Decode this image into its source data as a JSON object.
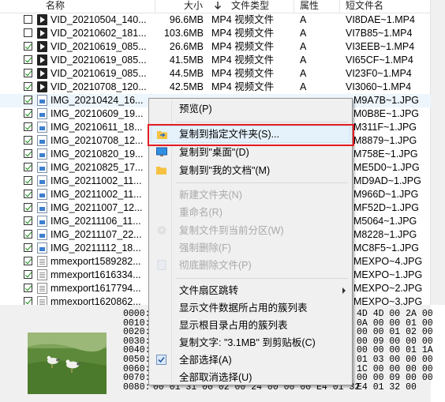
{
  "header": {
    "name": "名称",
    "size": "大小",
    "type": "文件类型",
    "attr": "属性",
    "short": "短文件名"
  },
  "rows": [
    {
      "icon": "video",
      "checked": false,
      "name": "VID_20210504_140...",
      "size": "96.6MB",
      "type": "MP4 视频文件",
      "attr": "A",
      "short": "VI8DAE~1.MP4"
    },
    {
      "icon": "video",
      "checked": false,
      "name": "VID_20210602_181...",
      "size": "103.6MB",
      "type": "MP4 视频文件",
      "attr": "A",
      "short": "VI7B85~1.MP4"
    },
    {
      "icon": "video",
      "checked": true,
      "name": "VID_20210619_085...",
      "size": "26.6MB",
      "type": "MP4 视频文件",
      "attr": "A",
      "short": "VI3EEB~1.MP4"
    },
    {
      "icon": "video",
      "checked": true,
      "name": "VID_20210619_085...",
      "size": "41.5MB",
      "type": "MP4 视频文件",
      "attr": "A",
      "short": "VI65CF~1.MP4"
    },
    {
      "icon": "video",
      "checked": true,
      "name": "VID_20210619_085...",
      "size": "44.5MB",
      "type": "MP4 视频文件",
      "attr": "A",
      "short": "VI23F0~1.MP4"
    },
    {
      "icon": "video",
      "checked": true,
      "name": "VID_20210708_120...",
      "size": "42.5MB",
      "type": "MP4 视频文件",
      "attr": "A",
      "short": "VI3060~1.MP4"
    },
    {
      "icon": "image",
      "checked": true,
      "name": "IMG_20210424_16...",
      "size": "",
      "type": "",
      "attr": "",
      "short": "M9A7B~1.JPG",
      "selected": true
    },
    {
      "icon": "image",
      "checked": true,
      "name": "IMG_20210609_19...",
      "size": "",
      "type": "",
      "attr": "",
      "short": "M0B8E~1.JPG"
    },
    {
      "icon": "image",
      "checked": true,
      "name": "IMG_20210611_18...",
      "size": "",
      "type": "",
      "attr": "",
      "short": "M311F~1.JPG"
    },
    {
      "icon": "image",
      "checked": true,
      "name": "IMG_20210708_12...",
      "size": "",
      "type": "",
      "attr": "",
      "short": "M8879~1.JPG"
    },
    {
      "icon": "image",
      "checked": true,
      "name": "IMG_20210820_19...",
      "size": "",
      "type": "",
      "attr": "",
      "short": "M758E~1.JPG"
    },
    {
      "icon": "image",
      "checked": true,
      "name": "IMG_20210825_17...",
      "size": "",
      "type": "",
      "attr": "",
      "short": "ME5D0~1.JPG"
    },
    {
      "icon": "image",
      "checked": true,
      "name": "IMG_20211002_11...",
      "size": "",
      "type": "",
      "attr": "",
      "short": "MD9AD~1.JPG"
    },
    {
      "icon": "image",
      "checked": true,
      "name": "IMG_20211002_11...",
      "size": "",
      "type": "",
      "attr": "",
      "short": "M966D~1.JPG"
    },
    {
      "icon": "image",
      "checked": true,
      "name": "IMG_20211007_12...",
      "size": "",
      "type": "",
      "attr": "",
      "short": "MF52D~1.JPG"
    },
    {
      "icon": "image",
      "checked": true,
      "name": "IMG_20211106_11...",
      "size": "",
      "type": "",
      "attr": "",
      "short": "M5064~1.JPG"
    },
    {
      "icon": "image",
      "checked": true,
      "name": "IMG_20211107_22...",
      "size": "",
      "type": "",
      "attr": "",
      "short": "M8228~1.JPG"
    },
    {
      "icon": "image",
      "checked": true,
      "name": "IMG_20211112_18...",
      "size": "",
      "type": "",
      "attr": "",
      "short": "MC8F5~1.JPG"
    },
    {
      "icon": "text",
      "checked": true,
      "name": "mmexport1589282...",
      "size": "",
      "type": "",
      "attr": "",
      "short": "MEXPO~4.JPG"
    },
    {
      "icon": "text",
      "checked": true,
      "name": "mmexport1616334...",
      "size": "",
      "type": "",
      "attr": "",
      "short": "MEXPO~1.JPG"
    },
    {
      "icon": "text",
      "checked": true,
      "name": "mmexport1617794...",
      "size": "",
      "type": "",
      "attr": "",
      "short": "MEXPO~2.JPG"
    },
    {
      "icon": "text",
      "checked": true,
      "name": "mmexport1620862...",
      "size": "",
      "type": "",
      "attr": "",
      "short": "MEXPO~3.JPG"
    }
  ],
  "hex": {
    "offsets": [
      "0000:",
      "0010:",
      "0020:",
      "0030:",
      "0040:",
      "0050:",
      "0060:",
      "0070:",
      "0080:"
    ],
    "right": [
      "4D 4D 00 2A 00",
      "0A 00 00 01 00",
      "00 00 01 02 00",
      "00 09 00 00 00",
      "00 00 00 01 1A",
      "01 03 00 00 00",
      "1C 00 00 00 00",
      "00 00 09 00 00",
      "E4 01 32 00"
    ],
    "last_line": "00 01 31 00 02 00 24 00 00 00 E4 01 32"
  },
  "menu": {
    "items": [
      {
        "label": "预览(P)",
        "state": "normal",
        "icon": ""
      },
      {
        "label": "复制到指定文件夹(S)...",
        "state": "highlighted",
        "icon": "folder-arrow-icon"
      },
      {
        "label": "复制到\"桌面\"(D)",
        "state": "normal",
        "icon": "desktop-icon"
      },
      {
        "label": "复制到\"我的文档\"(M)",
        "state": "normal",
        "icon": "folder-icon"
      },
      {
        "label": "新建文件夹(N)",
        "state": "disabled",
        "icon": ""
      },
      {
        "label": "重命名(R)",
        "state": "disabled",
        "icon": ""
      },
      {
        "label": "复制文件到当前分区(W)",
        "state": "disabled",
        "icon": "disk-icon"
      },
      {
        "label": "强制删除(F)",
        "state": "disabled",
        "icon": ""
      },
      {
        "label": "彻底删除文件(P)",
        "state": "disabled",
        "icon": "document-icon"
      },
      {
        "label": "文件扇区跳转",
        "state": "normal",
        "icon": "",
        "submenu": true
      },
      {
        "label": "显示文件数据所占用的簇列表",
        "state": "normal",
        "icon": ""
      },
      {
        "label": "显示根目录占用的簇列表",
        "state": "normal",
        "icon": ""
      },
      {
        "label": "复制文字: \"3.1MB\" 到剪贴板(C)",
        "state": "normal",
        "icon": ""
      },
      {
        "label": "全部选择(A)",
        "state": "normal",
        "icon": "checkbox-icon"
      },
      {
        "label": "全部取消选择(U)",
        "state": "normal",
        "icon": ""
      }
    ]
  },
  "colors": {
    "menu_bg": "#f0f0f0",
    "highlight": "#e5f1fb",
    "annotation_red": "#e51c23",
    "check_green": "#118a11"
  }
}
